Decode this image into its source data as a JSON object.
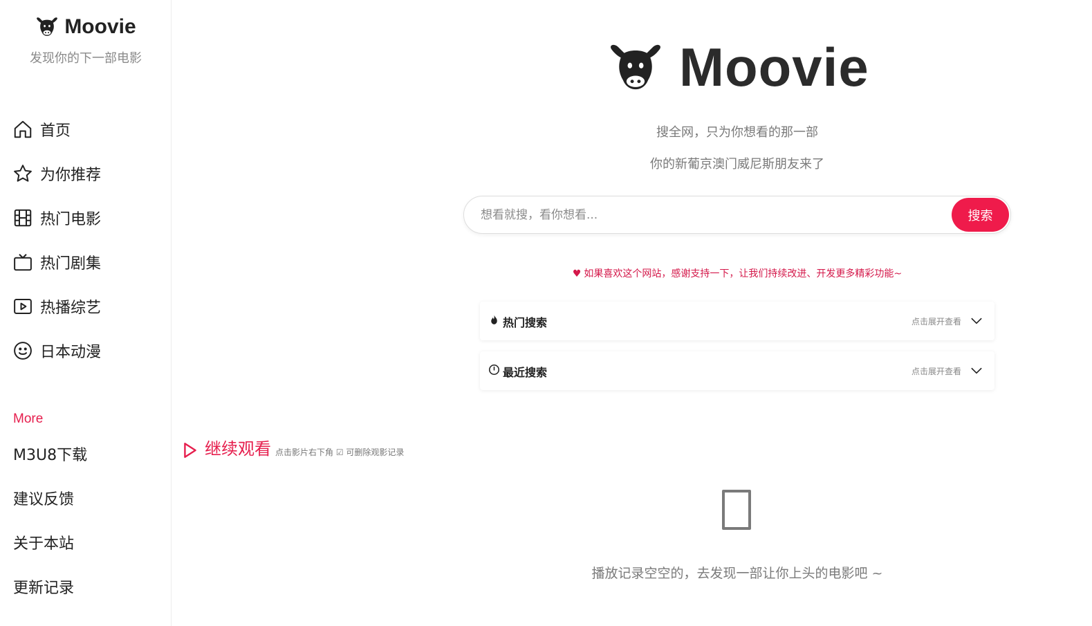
{
  "sidebar": {
    "brand_name": "Moovie",
    "tagline": "发现你的下一部电影",
    "nav": [
      {
        "label": "首页",
        "icon": "home-icon"
      },
      {
        "label": "为你推荐",
        "icon": "star-icon"
      },
      {
        "label": "热门电影",
        "icon": "film-icon"
      },
      {
        "label": "热门剧集",
        "icon": "tv-icon"
      },
      {
        "label": "热播综艺",
        "icon": "play-icon"
      },
      {
        "label": "日本动漫",
        "icon": "smile-icon"
      }
    ],
    "more_title": "More",
    "more": [
      {
        "label": "M3U8下载"
      },
      {
        "label": "建议反馈"
      },
      {
        "label": "关于本站"
      },
      {
        "label": "更新记录"
      }
    ]
  },
  "hero": {
    "title": "Moovie",
    "slogan_1": "搜全网，只为你想看的那一部",
    "slogan_2": "你的新葡京澳门威尼斯朋友来了"
  },
  "search": {
    "placeholder": "想看就搜，看你想看...",
    "button_label": "搜索"
  },
  "support_note": "如果喜欢这个网站，感谢支持一下，让我们持续改进、开发更多精彩功能~",
  "panels": {
    "hot": {
      "title": "热门搜索",
      "hint": "点击展开查看",
      "icon": "fire-icon"
    },
    "recent": {
      "title": "最近搜索",
      "hint": "点击展开查看",
      "icon": "clock-icon"
    }
  },
  "continue_watching": {
    "title": "继续观看",
    "hint": "点击影片右下角 ☑ 可删除观影记录"
  },
  "empty_state": {
    "text": "播放记录空空的，去发现一部让你上头的电影吧 ~"
  },
  "colors": {
    "accent": "#ef1b4b",
    "accent_text": "#e61e4d",
    "muted": "#7a7a7a"
  }
}
